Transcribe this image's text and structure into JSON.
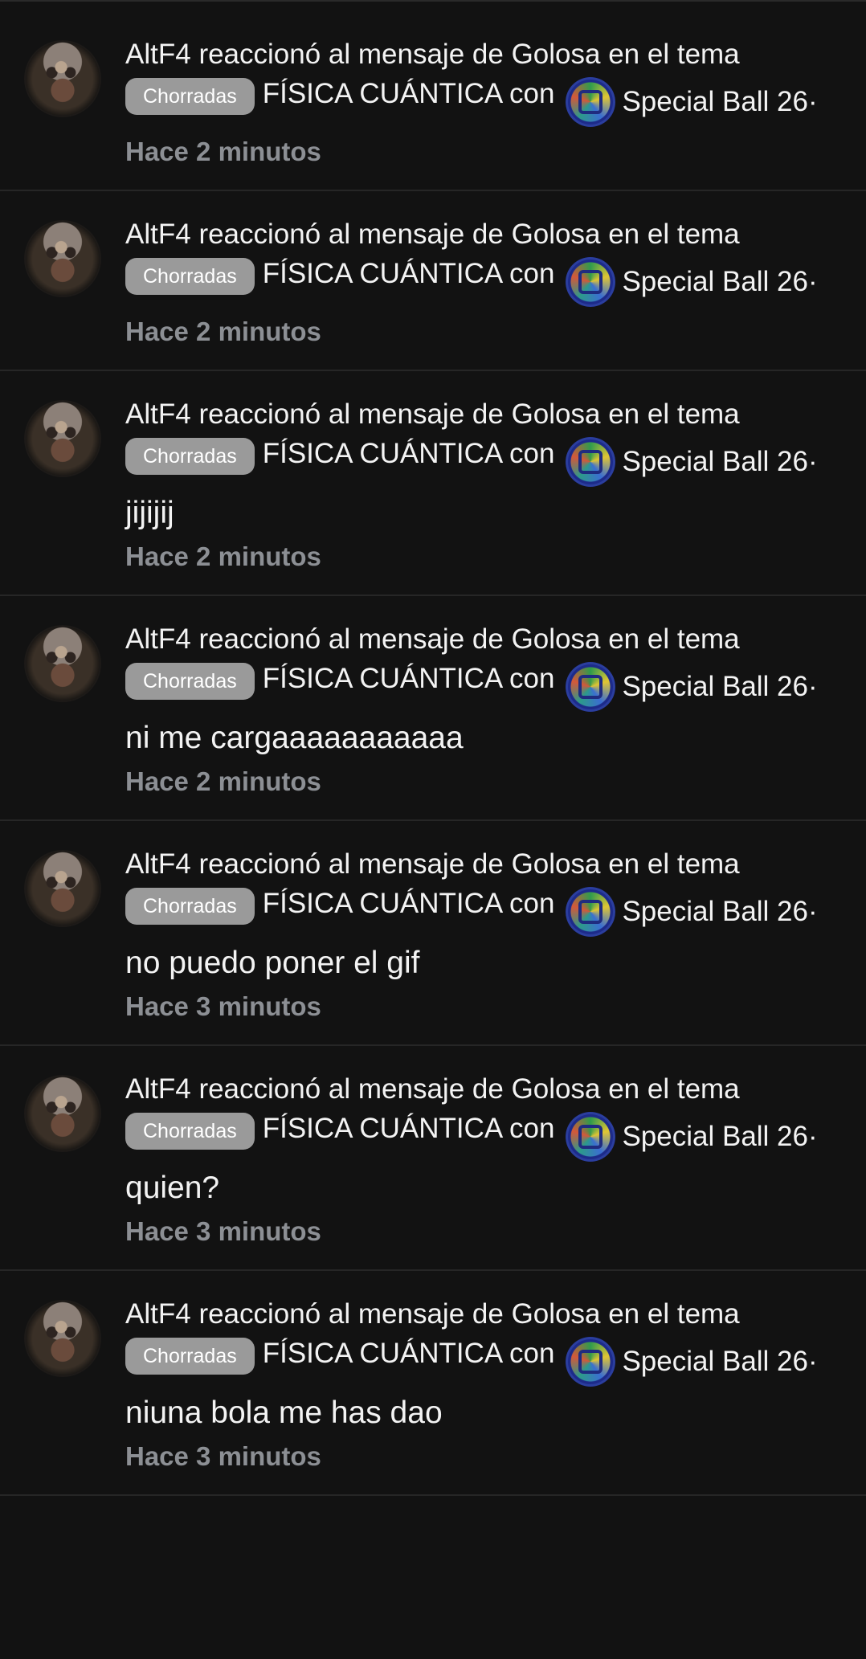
{
  "alerts": [
    {
      "actor": "AltF4",
      "action": "reaccionó al mensaje de",
      "target_user": "Golosa",
      "context": "en el tema",
      "prefix": "Chorradas",
      "thread_title": "FÍSICA CUÁNTICA con",
      "thread_suffix": "Special Ball 26·",
      "snippet": "",
      "time": "Hace 2 minutos"
    },
    {
      "actor": "AltF4",
      "action": "reaccionó al mensaje de",
      "target_user": "Golosa",
      "context": "en el tema",
      "prefix": "Chorradas",
      "thread_title": "FÍSICA CUÁNTICA con",
      "thread_suffix": "Special Ball 26·",
      "snippet": "",
      "time": "Hace 2 minutos"
    },
    {
      "actor": "AltF4",
      "action": "reaccionó al mensaje de",
      "target_user": "Golosa",
      "context": "en el tema",
      "prefix": "Chorradas",
      "thread_title": "FÍSICA CUÁNTICA con",
      "thread_suffix": "Special Ball 26·",
      "snippet": "jijijij",
      "time": "Hace 2 minutos"
    },
    {
      "actor": "AltF4",
      "action": "reaccionó al mensaje de",
      "target_user": "Golosa",
      "context": "en el tema",
      "prefix": "Chorradas",
      "thread_title": "FÍSICA CUÁNTICA con",
      "thread_suffix": "Special Ball 26·",
      "snippet": "ni me cargaaaaaaaaaaa",
      "time": "Hace 2 minutos"
    },
    {
      "actor": "AltF4",
      "action": "reaccionó al mensaje de",
      "target_user": "Golosa",
      "context": "en el tema",
      "prefix": "Chorradas",
      "thread_title": "FÍSICA CUÁNTICA con",
      "thread_suffix": "Special Ball 26·",
      "snippet": "no puedo poner el gif",
      "time": "Hace 3 minutos"
    },
    {
      "actor": "AltF4",
      "action": "reaccionó al mensaje de",
      "target_user": "Golosa",
      "context": "en el tema",
      "prefix": "Chorradas",
      "thread_title": "FÍSICA CUÁNTICA con",
      "thread_suffix": "Special Ball 26·",
      "snippet": "quien?",
      "time": "Hace 3 minutos"
    },
    {
      "actor": "AltF4",
      "action": "reaccionó al mensaje de",
      "target_user": "Golosa",
      "context": "en el tema",
      "prefix": "Chorradas",
      "thread_title": "FÍSICA CUÁNTICA con",
      "thread_suffix": "Special Ball 26·",
      "snippet": "niuna bola me has dao",
      "time": "Hace 3 minutos"
    }
  ],
  "icons": {
    "avatar": "user-avatar",
    "thread_icon": "special-ball-icon"
  },
  "colors": {
    "background": "#121212",
    "text": "#f3f3f3",
    "muted": "#8c8f94",
    "prefix_bg": "#9a9a9a",
    "divider": "#262626"
  }
}
